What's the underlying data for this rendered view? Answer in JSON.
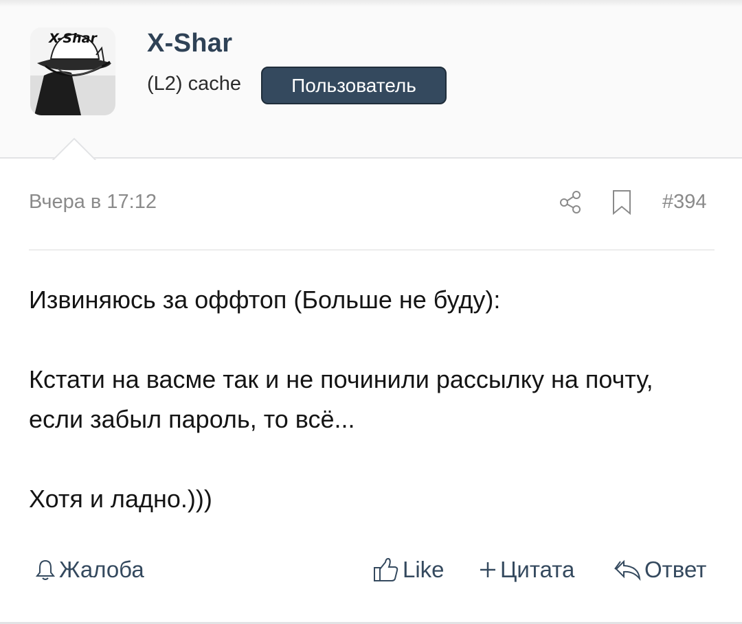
{
  "user": {
    "name": "X-Shar",
    "title": "(L2) cache",
    "badge": "Пользователь",
    "avatar_text": "X-Shar"
  },
  "post": {
    "date": "Вчера в 17:12",
    "number": "#394",
    "paragraphs": [
      "Извиняюсь за оффтоп (Больше не буду):",
      "Кстати на васме так и не починили рассылку на почту, если забыл пароль, то всё...",
      "Хотя и ладно.)))"
    ]
  },
  "actions": {
    "report": "Жалоба",
    "like": "Like",
    "quote": "Цитата",
    "reply": "Ответ"
  },
  "icons": {
    "share": "share-icon",
    "bookmark": "bookmark-icon",
    "report": "bell-icon",
    "like": "thumbs-up-icon",
    "quote": "plus-icon",
    "reply": "reply-icon"
  },
  "colors": {
    "username": "#2f4256",
    "badge_bg": "#34495e",
    "action_text": "#34495e",
    "meta_text": "#8a8a8a",
    "body_text": "#141414"
  }
}
